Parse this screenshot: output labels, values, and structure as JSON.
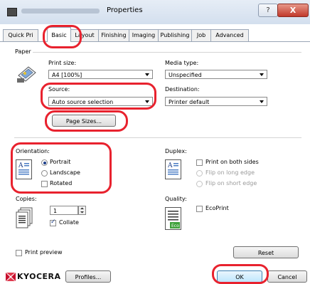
{
  "window": {
    "title": "Properties",
    "help_label": "?",
    "close_label": "X"
  },
  "tabs": [
    {
      "label": "Quick Pri"
    },
    {
      "label": "Basic"
    },
    {
      "label": "Layout"
    },
    {
      "label": "Finishing"
    },
    {
      "label": "Imaging"
    },
    {
      "label": "Publishing"
    },
    {
      "label": "Job"
    },
    {
      "label": "Advanced"
    }
  ],
  "paper": {
    "group_label": "Paper",
    "print_size_label": "Print size:",
    "print_size_value": "A4 [100%]",
    "media_type_label": "Media type:",
    "media_type_value": "Unspecified",
    "source_label": "Source:",
    "source_value": "Auto source selection",
    "destination_label": "Destination:",
    "destination_value": "Printer default",
    "page_sizes_button": "Page Sizes..."
  },
  "orientation": {
    "label": "Orientation:",
    "portrait": "Portrait",
    "landscape": "Landscape",
    "rotated": "Rotated"
  },
  "duplex": {
    "label": "Duplex:",
    "print_both_sides": "Print on both sides",
    "flip_long": "Flip on long edge",
    "flip_short": "Flip on short edge"
  },
  "copies": {
    "label": "Copies:",
    "value": "1",
    "collate": "Collate"
  },
  "quality": {
    "label": "Quality:",
    "ecoprint": "EcoPrint",
    "eco_tag": "Eco"
  },
  "print_preview": "Print preview",
  "reset_button": "Reset",
  "footer": {
    "logo_text": "KYOCERA",
    "profiles_button": "Profiles...",
    "ok_button": "OK",
    "cancel_button": "Cancel"
  },
  "colors": {
    "highlight": "#e8222e",
    "accent": "#1c3f8a",
    "logo": "#c8102e"
  }
}
